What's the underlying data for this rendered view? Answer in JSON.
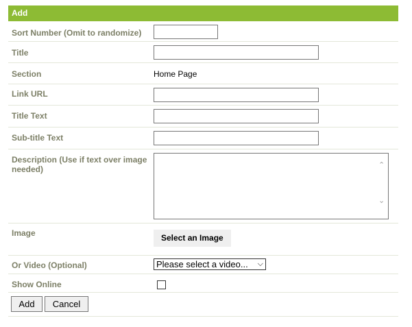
{
  "form": {
    "header": "Add",
    "sort_number": {
      "label": "Sort Number (Omit to randomize)",
      "value": ""
    },
    "title": {
      "label": "Title",
      "value": ""
    },
    "section": {
      "label": "Section",
      "value": "Home Page"
    },
    "link_url": {
      "label": "Link URL",
      "value": ""
    },
    "title_text": {
      "label": "Title Text",
      "value": ""
    },
    "subtitle_text": {
      "label": "Sub-title Text",
      "value": ""
    },
    "description": {
      "label": "Description (Use if text over image needed)",
      "value": ""
    },
    "image": {
      "label": "Image",
      "button_label": "Select an Image"
    },
    "video": {
      "label": "Or Video (Optional)",
      "selected": "Please select a video..."
    },
    "show_online": {
      "label": "Show Online",
      "checked": false
    },
    "actions": {
      "add_label": "Add",
      "cancel_label": "Cancel"
    }
  },
  "colors": {
    "header_bg": "#8dbb34",
    "label": "#7c7f66",
    "row_border": "#e3e7d9"
  }
}
